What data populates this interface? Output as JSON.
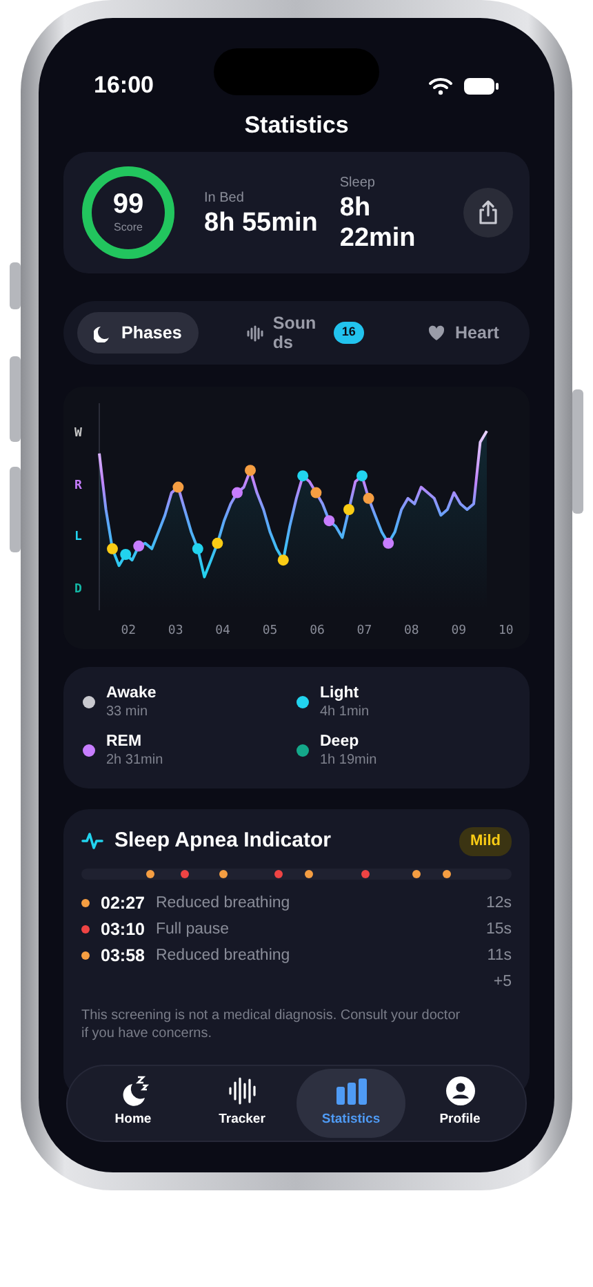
{
  "status_bar": {
    "time": "16:00"
  },
  "title": "Statistics",
  "summary": {
    "score": "99",
    "score_label": "Score",
    "in_bed_label": "In Bed",
    "in_bed": "8h 55min",
    "sleep_label": "Sleep",
    "sleep": "8h 22min"
  },
  "tabs": [
    {
      "label": "Phases",
      "kind": "moon",
      "selected": true
    },
    {
      "label": "Sounds",
      "kind": "wave",
      "badge": "16",
      "selected": false
    },
    {
      "label": "Heart",
      "kind": "heart",
      "selected": false
    }
  ],
  "chart": {
    "y_labels": [
      {
        "label": "W",
        "color": "#c8c8c8"
      },
      {
        "label": "R",
        "color": "#c77dff"
      },
      {
        "label": "L",
        "color": "#22d3ee"
      },
      {
        "label": "D",
        "color": "#14b8a6"
      }
    ],
    "x_labels": [
      "02",
      "03",
      "04",
      "05",
      "06",
      "07",
      "08",
      "09",
      "10"
    ]
  },
  "legend": [
    {
      "name": "Awake",
      "value": "33 min",
      "color": "#c9c9cf"
    },
    {
      "name": "Light",
      "value": "4h 1min",
      "color": "#22d3ee"
    },
    {
      "name": "REM",
      "value": "2h 31min",
      "color": "#c77dff"
    },
    {
      "name": "Deep",
      "value": "1h 19min",
      "color": "#14a88a"
    }
  ],
  "apnea": {
    "title": "Sleep Apnea Indicator",
    "severity": "Mild",
    "timeline": [
      {
        "color": "#f59e42"
      },
      {
        "color": "#ef4444"
      },
      {
        "color": "#f59e42"
      },
      {
        "color": "#ef4444"
      },
      {
        "color": "#f59e42"
      },
      {
        "color": "#ef4444"
      },
      {
        "color": "#f59e42"
      },
      {
        "color": "#f59e42"
      }
    ],
    "events": [
      {
        "time": "02:27",
        "label": "Reduced breathing",
        "duration": "12s",
        "color": "#f59e42"
      },
      {
        "time": "03:10",
        "label": "Full pause",
        "duration": "15s",
        "color": "#ef4444"
      },
      {
        "time": "03:58",
        "label": "Reduced breathing",
        "duration": "11s",
        "color": "#f59e42"
      }
    ],
    "more": "+5",
    "disclaimer": "This screening is not a medical diagnosis. Consult your doctor if you have concerns."
  },
  "nav": [
    {
      "label": "Home",
      "kind": "home",
      "selected": false
    },
    {
      "label": "Tracker",
      "kind": "tracker",
      "selected": false
    },
    {
      "label": "Statistics",
      "kind": "stats",
      "selected": true
    },
    {
      "label": "Profile",
      "kind": "profile",
      "selected": false
    }
  ]
}
